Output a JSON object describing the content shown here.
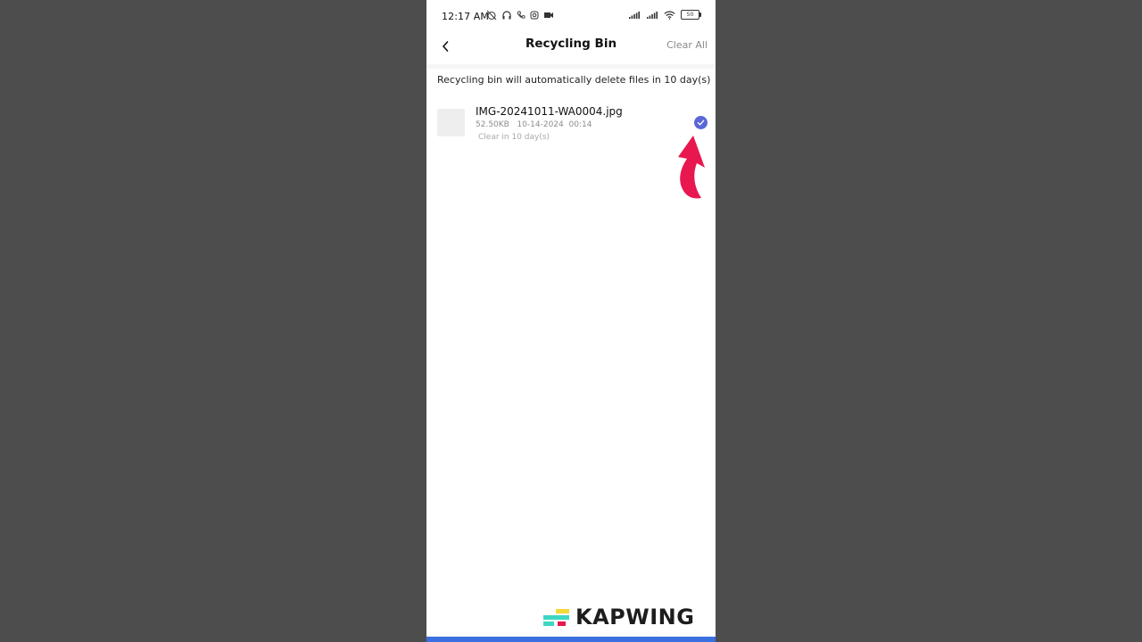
{
  "status_bar": {
    "time": "12:17 AM",
    "battery": "50"
  },
  "header": {
    "title": "Recycling Bin",
    "clear_all_label": "Clear All"
  },
  "notice": "Recycling bin will automatically delete files in 10 day(s)",
  "files": [
    {
      "name": "IMG-20241011-WA0004.jpg",
      "size": "52.50KB",
      "date": "10-14-2024",
      "time": "00:14",
      "clear_in": "Clear in 10 day(s)",
      "selected": true
    }
  ],
  "watermark": "KAPWING",
  "colors": {
    "accent": "#5a67d8",
    "arrow": "#e8174f",
    "background": "#4d4d4d",
    "bottom_bar": "#3b6fe0"
  },
  "icons": {
    "back": "chevron-left-icon",
    "check": "check-circle-icon",
    "arrow": "curved-arrow-icon"
  }
}
